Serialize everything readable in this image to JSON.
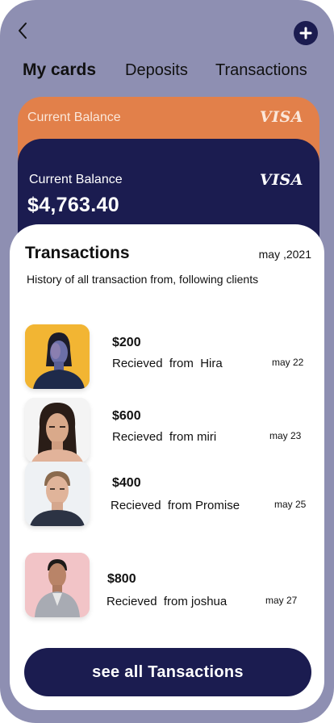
{
  "header": {
    "back_icon": "chevron-left-icon",
    "add_icon": "plus-icon"
  },
  "tabs": [
    {
      "label": "My  cards",
      "active": true
    },
    {
      "label": "Deposits",
      "active": false
    },
    {
      "label": "Transactions",
      "active": false
    }
  ],
  "cards": [
    {
      "label": "Current Balance",
      "brand": "VISA",
      "color": "#e2804a"
    },
    {
      "label": "Current Balance",
      "brand": "VISA",
      "balance": "$4,763.40",
      "color": "#1b1c50"
    }
  ],
  "sheet": {
    "title": "Transactions",
    "date": "may ,2021",
    "subtitle": "History of all transaction from, following clients",
    "transactions": [
      {
        "amount": "$200",
        "desc": "Recieved  from  Hira",
        "date": "may 22",
        "avatar_bg": "#f2b533"
      },
      {
        "amount": "$600",
        "desc": "Recieved  from miri",
        "date": "may 23",
        "avatar_bg": "#f4f4f4"
      },
      {
        "amount": "$400",
        "desc": "Recieved  from Promise",
        "date": "may 25",
        "avatar_bg": "#eef1f4"
      },
      {
        "amount": "$800",
        "desc": "Recieved  from joshua",
        "date": "may 27",
        "avatar_bg": "#f2c4c7"
      }
    ],
    "cta_label": "see all Tansactions"
  },
  "colors": {
    "frame": "#8e8fb2",
    "navy": "#1b1c50",
    "orange": "#e2804a"
  }
}
